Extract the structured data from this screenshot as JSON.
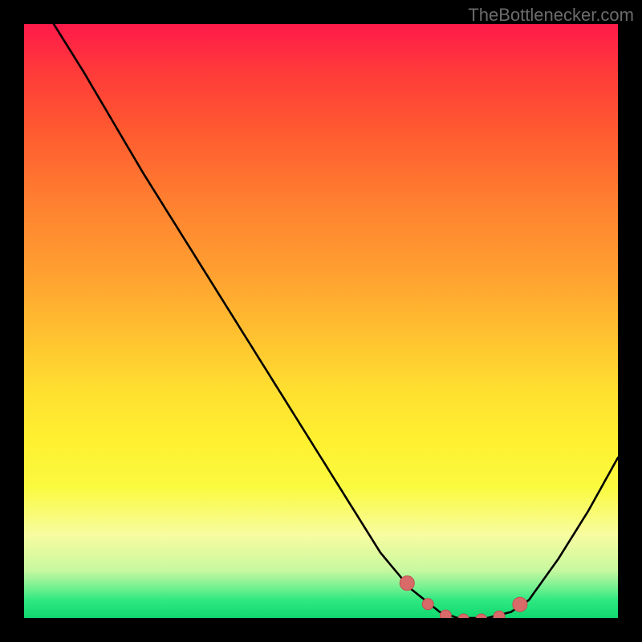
{
  "attribution": "TheBottlenecker.com",
  "chart_data": {
    "type": "line",
    "title": "",
    "xlabel": "",
    "ylabel": "",
    "xlim": [
      0,
      100
    ],
    "ylim": [
      0,
      100
    ],
    "curve": [
      {
        "x": 5,
        "y": 100
      },
      {
        "x": 10,
        "y": 92
      },
      {
        "x": 20,
        "y": 75
      },
      {
        "x": 30,
        "y": 59
      },
      {
        "x": 40,
        "y": 43
      },
      {
        "x": 50,
        "y": 27
      },
      {
        "x": 55,
        "y": 19
      },
      {
        "x": 60,
        "y": 11
      },
      {
        "x": 65,
        "y": 5
      },
      {
        "x": 70,
        "y": 1
      },
      {
        "x": 73,
        "y": 0
      },
      {
        "x": 78,
        "y": 0
      },
      {
        "x": 82,
        "y": 1
      },
      {
        "x": 85,
        "y": 3
      },
      {
        "x": 90,
        "y": 10
      },
      {
        "x": 95,
        "y": 18
      },
      {
        "x": 100,
        "y": 27
      }
    ],
    "highlight_x_range": [
      64,
      84
    ],
    "highlight_dots_x": [
      64.5,
      68,
      71,
      74,
      77,
      80,
      83.5
    ]
  },
  "colors": {
    "page_bg": "#000000",
    "curve": "#000000",
    "dot_fill": "#d96a6a",
    "text": "#6b6b6b"
  }
}
